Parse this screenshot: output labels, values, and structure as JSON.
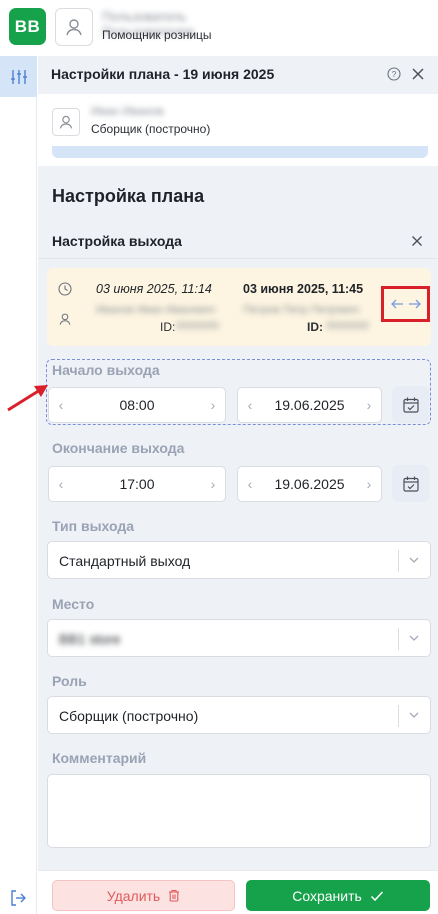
{
  "app": {
    "logo_text": "ВВ",
    "user_name": "Пользователь Пользователев",
    "user_role": "Помощник розницы"
  },
  "panel": {
    "title": "Настройки плана - 19 июня 2025",
    "employee_name": "Иван Иванов",
    "employee_role": "Сборщик (построчно)"
  },
  "form": {
    "section_title": "Настройка плана",
    "subsection_title": "Настройка выхода",
    "history": {
      "left": {
        "date": "03 июня 2025, 11:14",
        "name": "Иванов Иван Иванович",
        "id_label": "ID:",
        "id_value": "0000000"
      },
      "right": {
        "date": "03 июня 2025, 11:45",
        "name": "Петров Петр Петрович",
        "id_label": "ID:",
        "id_value": "0000000"
      }
    },
    "start": {
      "label": "Начало выхода",
      "time": "08:00",
      "date": "19.06.2025"
    },
    "end": {
      "label": "Окончание выхода",
      "time": "17:00",
      "date": "19.06.2025"
    },
    "type": {
      "label": "Тип выхода",
      "value": "Стандартный выход"
    },
    "place": {
      "label": "Место",
      "value": "ВВ1 store"
    },
    "role": {
      "label": "Роль",
      "value": "Сборщик (построчно)"
    },
    "comment": {
      "label": "Комментарий",
      "value": ""
    }
  },
  "actions": {
    "delete_label": "Удалить",
    "save_label": "Сохранить"
  },
  "colors": {
    "brand_green": "#16a24a",
    "active_nav": "#d6e4f7",
    "history_bg": "#fdf5e1",
    "highlight_red": "#d9202a",
    "delete_bg": "#fde2e2"
  },
  "icons": [
    "user-icon",
    "sliders-icon",
    "help-icon",
    "close-icon",
    "clock-icon",
    "swap-arrows-icon",
    "calendar-icon",
    "chevron-left-icon",
    "chevron-right-icon",
    "chevron-down-icon",
    "trash-icon",
    "check-icon",
    "logout-icon"
  ]
}
